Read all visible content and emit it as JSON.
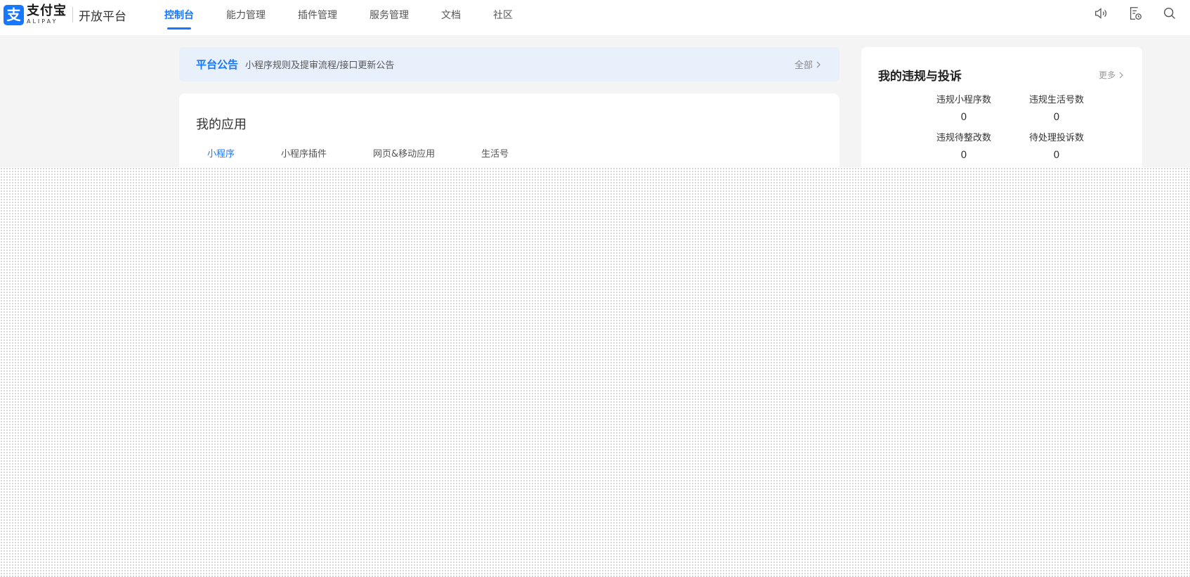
{
  "header": {
    "logo_mark": "支",
    "logo_cn": "支付宝",
    "logo_en": "ALIPAY",
    "logo_sub": "开放平台",
    "nav": [
      {
        "label": "控制台",
        "active": true
      },
      {
        "label": "能力管理",
        "active": false
      },
      {
        "label": "插件管理",
        "active": false
      },
      {
        "label": "服务管理",
        "active": false
      },
      {
        "label": "文档",
        "active": false
      },
      {
        "label": "社区",
        "active": false
      }
    ],
    "icons": [
      "speaker-icon",
      "document-clock-icon",
      "search-icon"
    ]
  },
  "notice": {
    "title": "平台公告",
    "text": "小程序规则及提审流程/接口更新公告",
    "all_label": "全部"
  },
  "apps": {
    "title": "我的应用",
    "tabs": [
      {
        "label": "小程序",
        "active": true
      },
      {
        "label": "小程序插件",
        "active": false
      },
      {
        "label": "网页&移动应用",
        "active": false
      },
      {
        "label": "生活号",
        "active": false
      }
    ]
  },
  "violations": {
    "title": "我的违规与投诉",
    "more_label": "更多",
    "stats": [
      {
        "label": "违规小程序数",
        "value": "0"
      },
      {
        "label": "违规生活号数",
        "value": "0"
      },
      {
        "label": "违规待整改数",
        "value": "0"
      },
      {
        "label": "待处理投诉数",
        "value": "0"
      }
    ]
  },
  "colors": {
    "accent": "#1677ff",
    "notice_bg": "#e7f0fb",
    "page_bg": "#f4f4f4"
  }
}
